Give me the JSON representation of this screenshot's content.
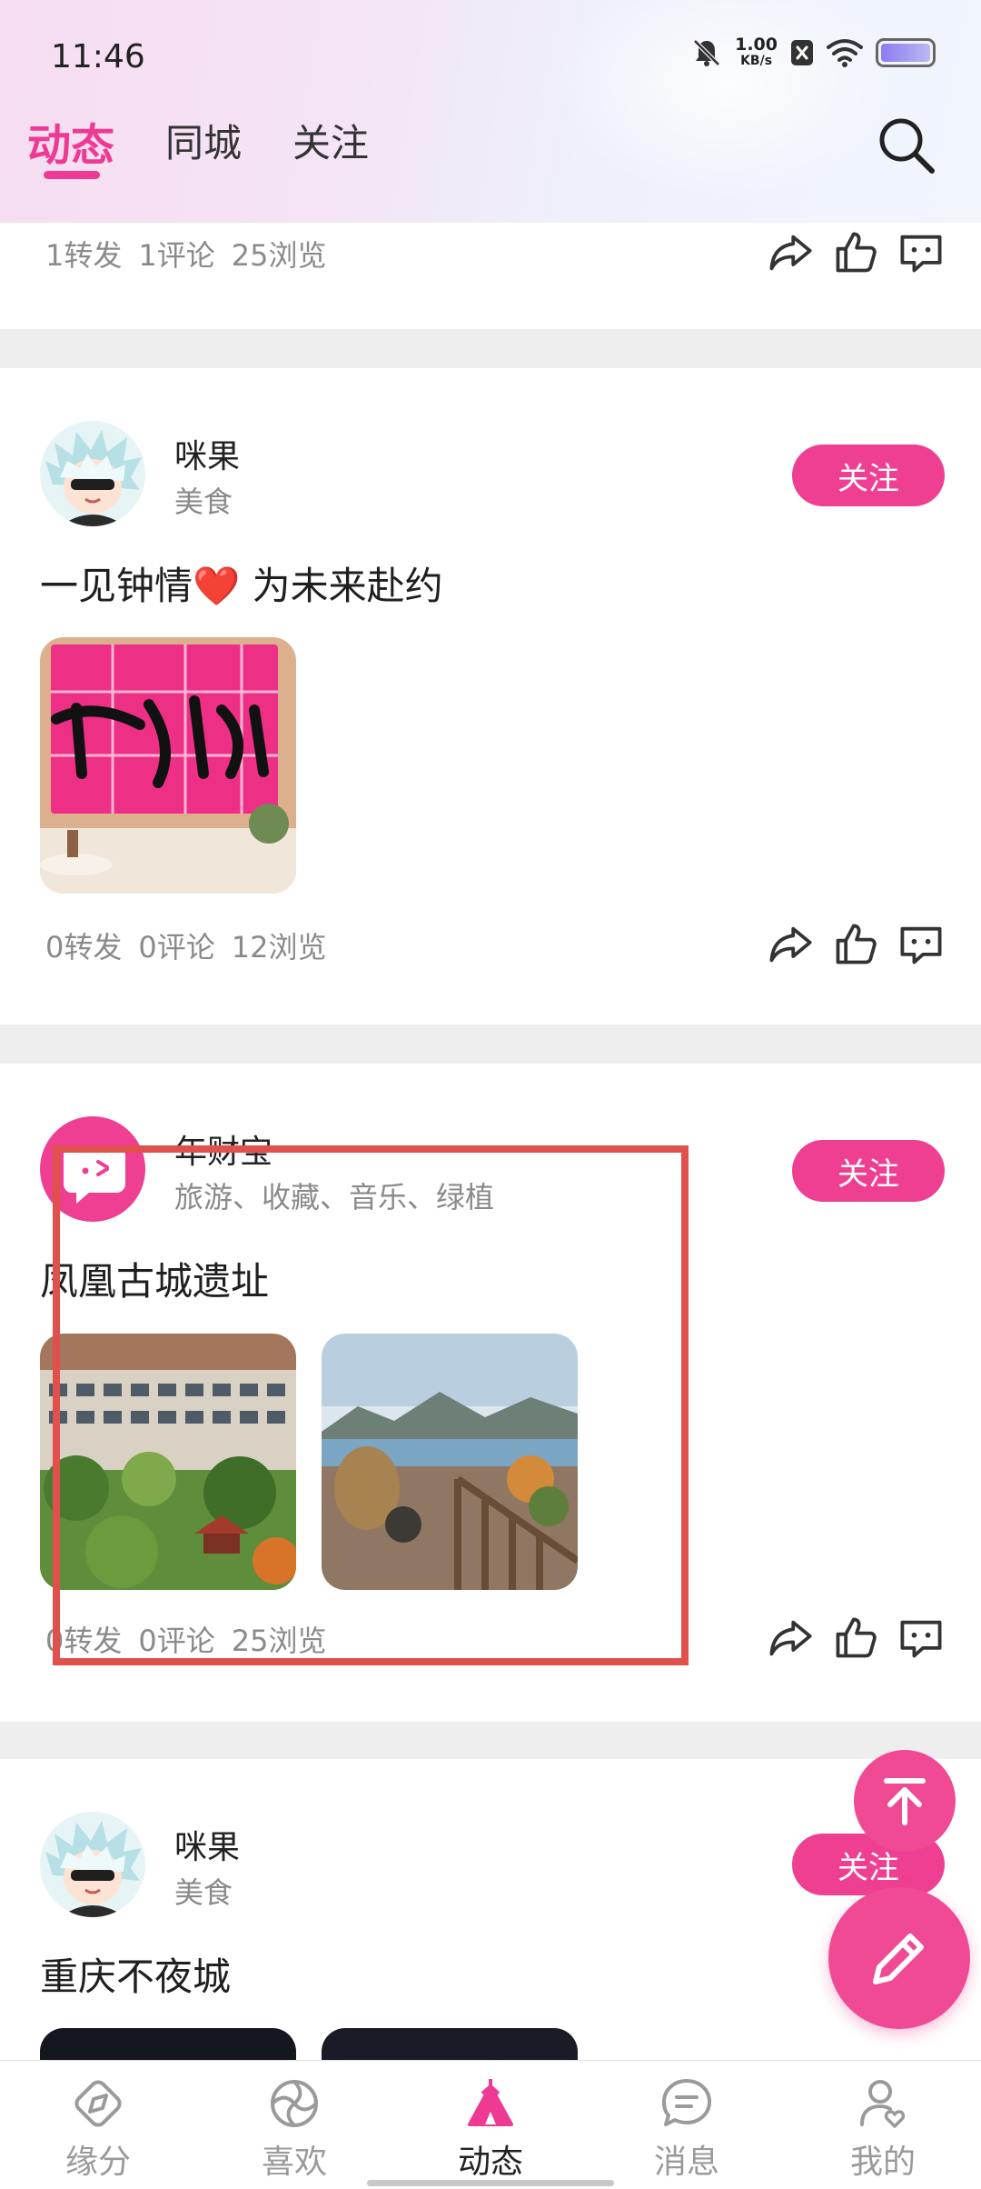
{
  "status_bar": {
    "time": "11:46",
    "net_speed": "1.00",
    "net_unit": "KB/s"
  },
  "tabs": [
    {
      "label": "动态",
      "active": true
    },
    {
      "label": "同城",
      "active": false
    },
    {
      "label": "关注",
      "active": false
    }
  ],
  "feed": {
    "partial_post": {
      "shares": "1转发",
      "comments": "1评论",
      "views": "25浏览"
    },
    "posts": [
      {
        "user": "咪果",
        "tags": "美食",
        "follow": "关注",
        "title": "一见钟情❤️ 为未来赴约",
        "shares": "0转发",
        "comments": "0评论",
        "views": "12浏览"
      },
      {
        "user": "年财宝",
        "tags": "旅游、收藏、音乐、绿植",
        "follow": "关注",
        "title": "凤凰古城遗址",
        "shares": "0转发",
        "comments": "0评论",
        "views": "25浏览"
      },
      {
        "user": "咪果",
        "tags": "美食",
        "follow": "关注",
        "title": "重庆不夜城"
      }
    ]
  },
  "bottom_nav": [
    {
      "label": "缘分",
      "icon": "compass-icon"
    },
    {
      "label": "喜欢",
      "icon": "swirl-icon"
    },
    {
      "label": "动态",
      "icon": "tent-icon",
      "active": true
    },
    {
      "label": "消息",
      "icon": "chat-icon"
    },
    {
      "label": "我的",
      "icon": "profile-icon"
    }
  ],
  "colors": {
    "accent": "#ef3f92",
    "highlight": "#e0504d"
  }
}
